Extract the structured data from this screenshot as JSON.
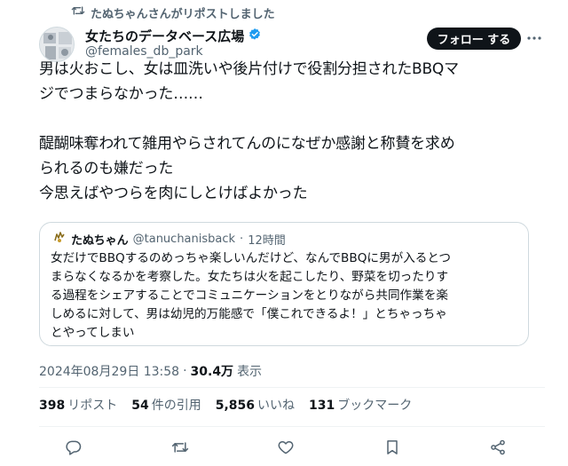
{
  "repost_notice": "たぬちゃんさんがリポストしました",
  "author": {
    "name": "女たちのデータベース広場",
    "handle": "@females_db_park",
    "verified_color": "#1d9bf0"
  },
  "follow_label": "フォロー する",
  "tweet_text": "男は火おこし、女は皿洗いや後片付けで役割分担されたBBQマ\nジでつまらなかった……\n\n醍醐味奪われて雑用やらされてんのになぜか感謝と称賛を求め\nられるのも嫌だった\n今思えばやつらを肉にしとけばよかった",
  "quote": {
    "name": "たぬちゃん",
    "handle": "@tanuchanisback",
    "separator": "·",
    "time": "12時間",
    "text": "女だけでBBQするのめっちゃ楽しいんだけど、なんでBBQに男が入るとつ\nまらなくなるかを考察した。女たちは火を起こしたり、野菜を切ったりす\nる過程をシェアすることでコミュニケーションをとりながら共同作業を楽\nしめるに対して、男は幼児的万能感で「僕これできるよ！」とちゃっちゃ\nとやってしまい"
  },
  "timestamp": {
    "datetime": "2024年08月29日 13:58",
    "dot": "·",
    "views": "30.4万",
    "views_label": "表示"
  },
  "stats": [
    {
      "count": "398",
      "label": "リポスト"
    },
    {
      "count": "54",
      "label": "件の引用"
    },
    {
      "count": "5,856",
      "label": "いいね"
    },
    {
      "count": "131",
      "label": "ブックマーク"
    }
  ],
  "colors": {
    "text": "#0f1419",
    "secondary": "#536471",
    "border": "#cfd9de",
    "accent": "#1d9bf0"
  },
  "icons": [
    "repost-icon",
    "verified-icon",
    "more-icon",
    "reply-icon",
    "retweet-icon",
    "like-icon",
    "bookmark-icon",
    "share-icon"
  ]
}
